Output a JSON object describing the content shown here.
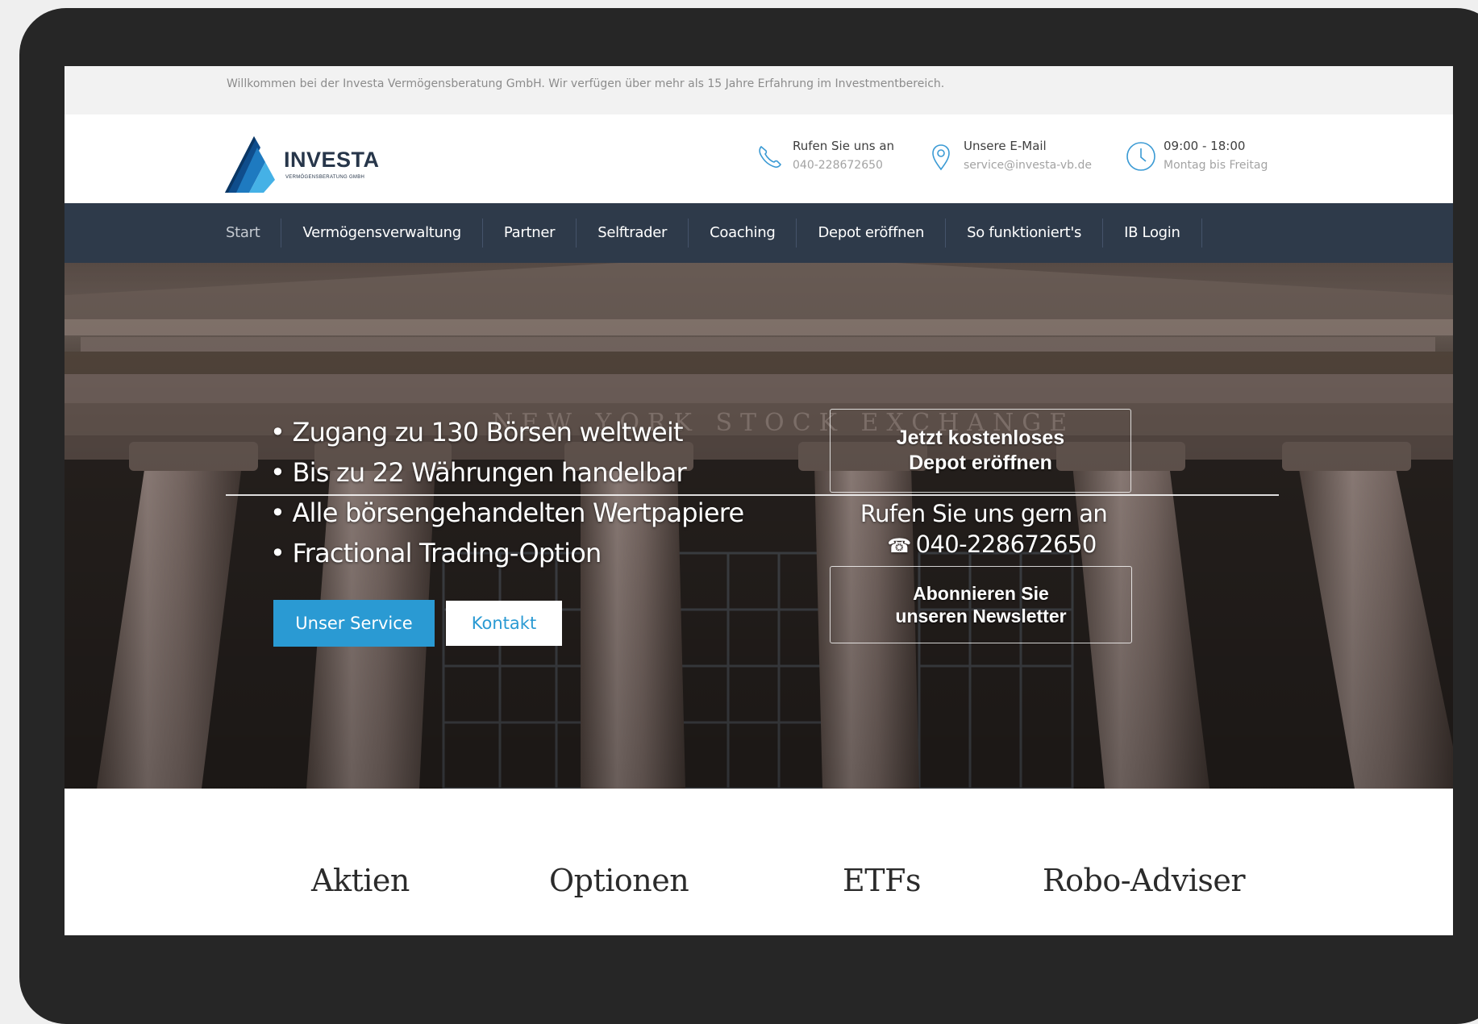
{
  "topbar": {
    "welcome": "Willkommen bei der Investa Vermögensberatung GmbH. Wir verfügen über mehr als 15 Jahre Erfahrung im Investmentbereich."
  },
  "header": {
    "logo_name": "INVESTA",
    "logo_tagline": "VERMÖGENSBERATUNG GMBH",
    "contacts": [
      {
        "icon": "phone-icon",
        "label": "Rufen Sie uns an",
        "value": "040-228672650"
      },
      {
        "icon": "location-pin-icon",
        "label": "Unsere E-Mail",
        "value": "service@investa-vb.de"
      },
      {
        "icon": "clock-icon",
        "label": "09:00 - 18:00",
        "value": "Montag bis Freitag"
      }
    ]
  },
  "nav": {
    "items": [
      "Start",
      "Vermögensverwaltung",
      "Partner",
      "Selftrader",
      "Coaching",
      "Depot eröffnen",
      "So funktioniert's",
      "IB Login"
    ]
  },
  "hero": {
    "bullets": [
      "• Zugang zu 130 Börsen weltweit",
      "• Bis zu 22 Währungen handelbar",
      "• Alle börsengehandelten Wertpapiere",
      "• Fractional Trading-Option"
    ],
    "primary_button": "Unser Service",
    "secondary_button": "Kontakt",
    "cta_depot_line1": "Jetzt kostenloses",
    "cta_depot_line2": "Depot eröffnen",
    "call_label": "Rufen Sie uns gern an",
    "call_phone": "040-228672650",
    "cta_newsletter_line1": "Abonnieren Sie",
    "cta_newsletter_line2": "unseren Newsletter",
    "background_text": "NEW YORK STOCK EXCHANGE"
  },
  "categories": [
    "Aktien",
    "Optionen",
    "ETFs",
    "Robo-Adviser"
  ],
  "colors": {
    "frame": "#262626",
    "nav_bg": "#2e3a4a",
    "accent_blue": "#2a9ad3",
    "logo_dark": "#27364a"
  }
}
